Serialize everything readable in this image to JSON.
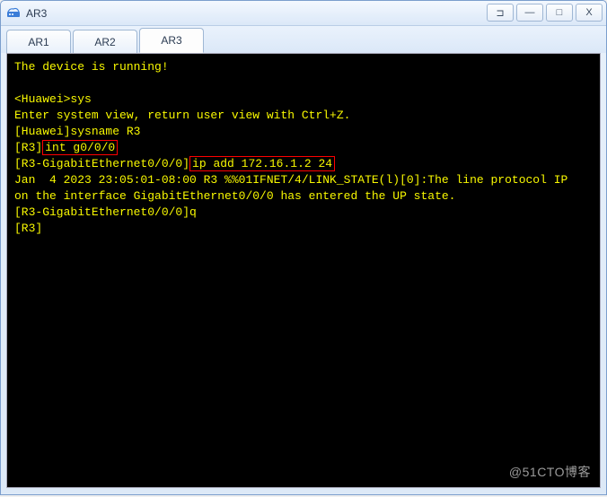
{
  "window": {
    "title": "AR3"
  },
  "tabs": [
    {
      "label": "AR1",
      "active": false
    },
    {
      "label": "AR2",
      "active": false
    },
    {
      "label": "AR3",
      "active": true
    }
  ],
  "terminal": {
    "running": "The device is running!",
    "blank": " ",
    "prompt_sys": "<Huawei>sys",
    "enter_view": "Enter system view, return user view with Ctrl+Z.",
    "sysname": "[Huawei]sysname R3",
    "r3_prefix": "[R3]",
    "int_cmd": "int g0/0/0",
    "gi_prefix": "[R3-GigabitEthernet0/0/0]",
    "ip_cmd": "ip add 172.16.1.2 24",
    "log1": "Jan  4 2023 23:05:01-08:00 R3 %%01IFNET/4/LINK_STATE(l)[0]:The line protocol IP ",
    "log2": "on the interface GigabitEthernet0/0/0 has entered the UP state.",
    "quit": "[R3-GigabitEthernet0/0/0]q",
    "r3_final": "[R3]"
  },
  "watermark": "@51CTO博客",
  "icons": {
    "pin": "⊐",
    "min": "—",
    "max": "□",
    "close": "X"
  }
}
